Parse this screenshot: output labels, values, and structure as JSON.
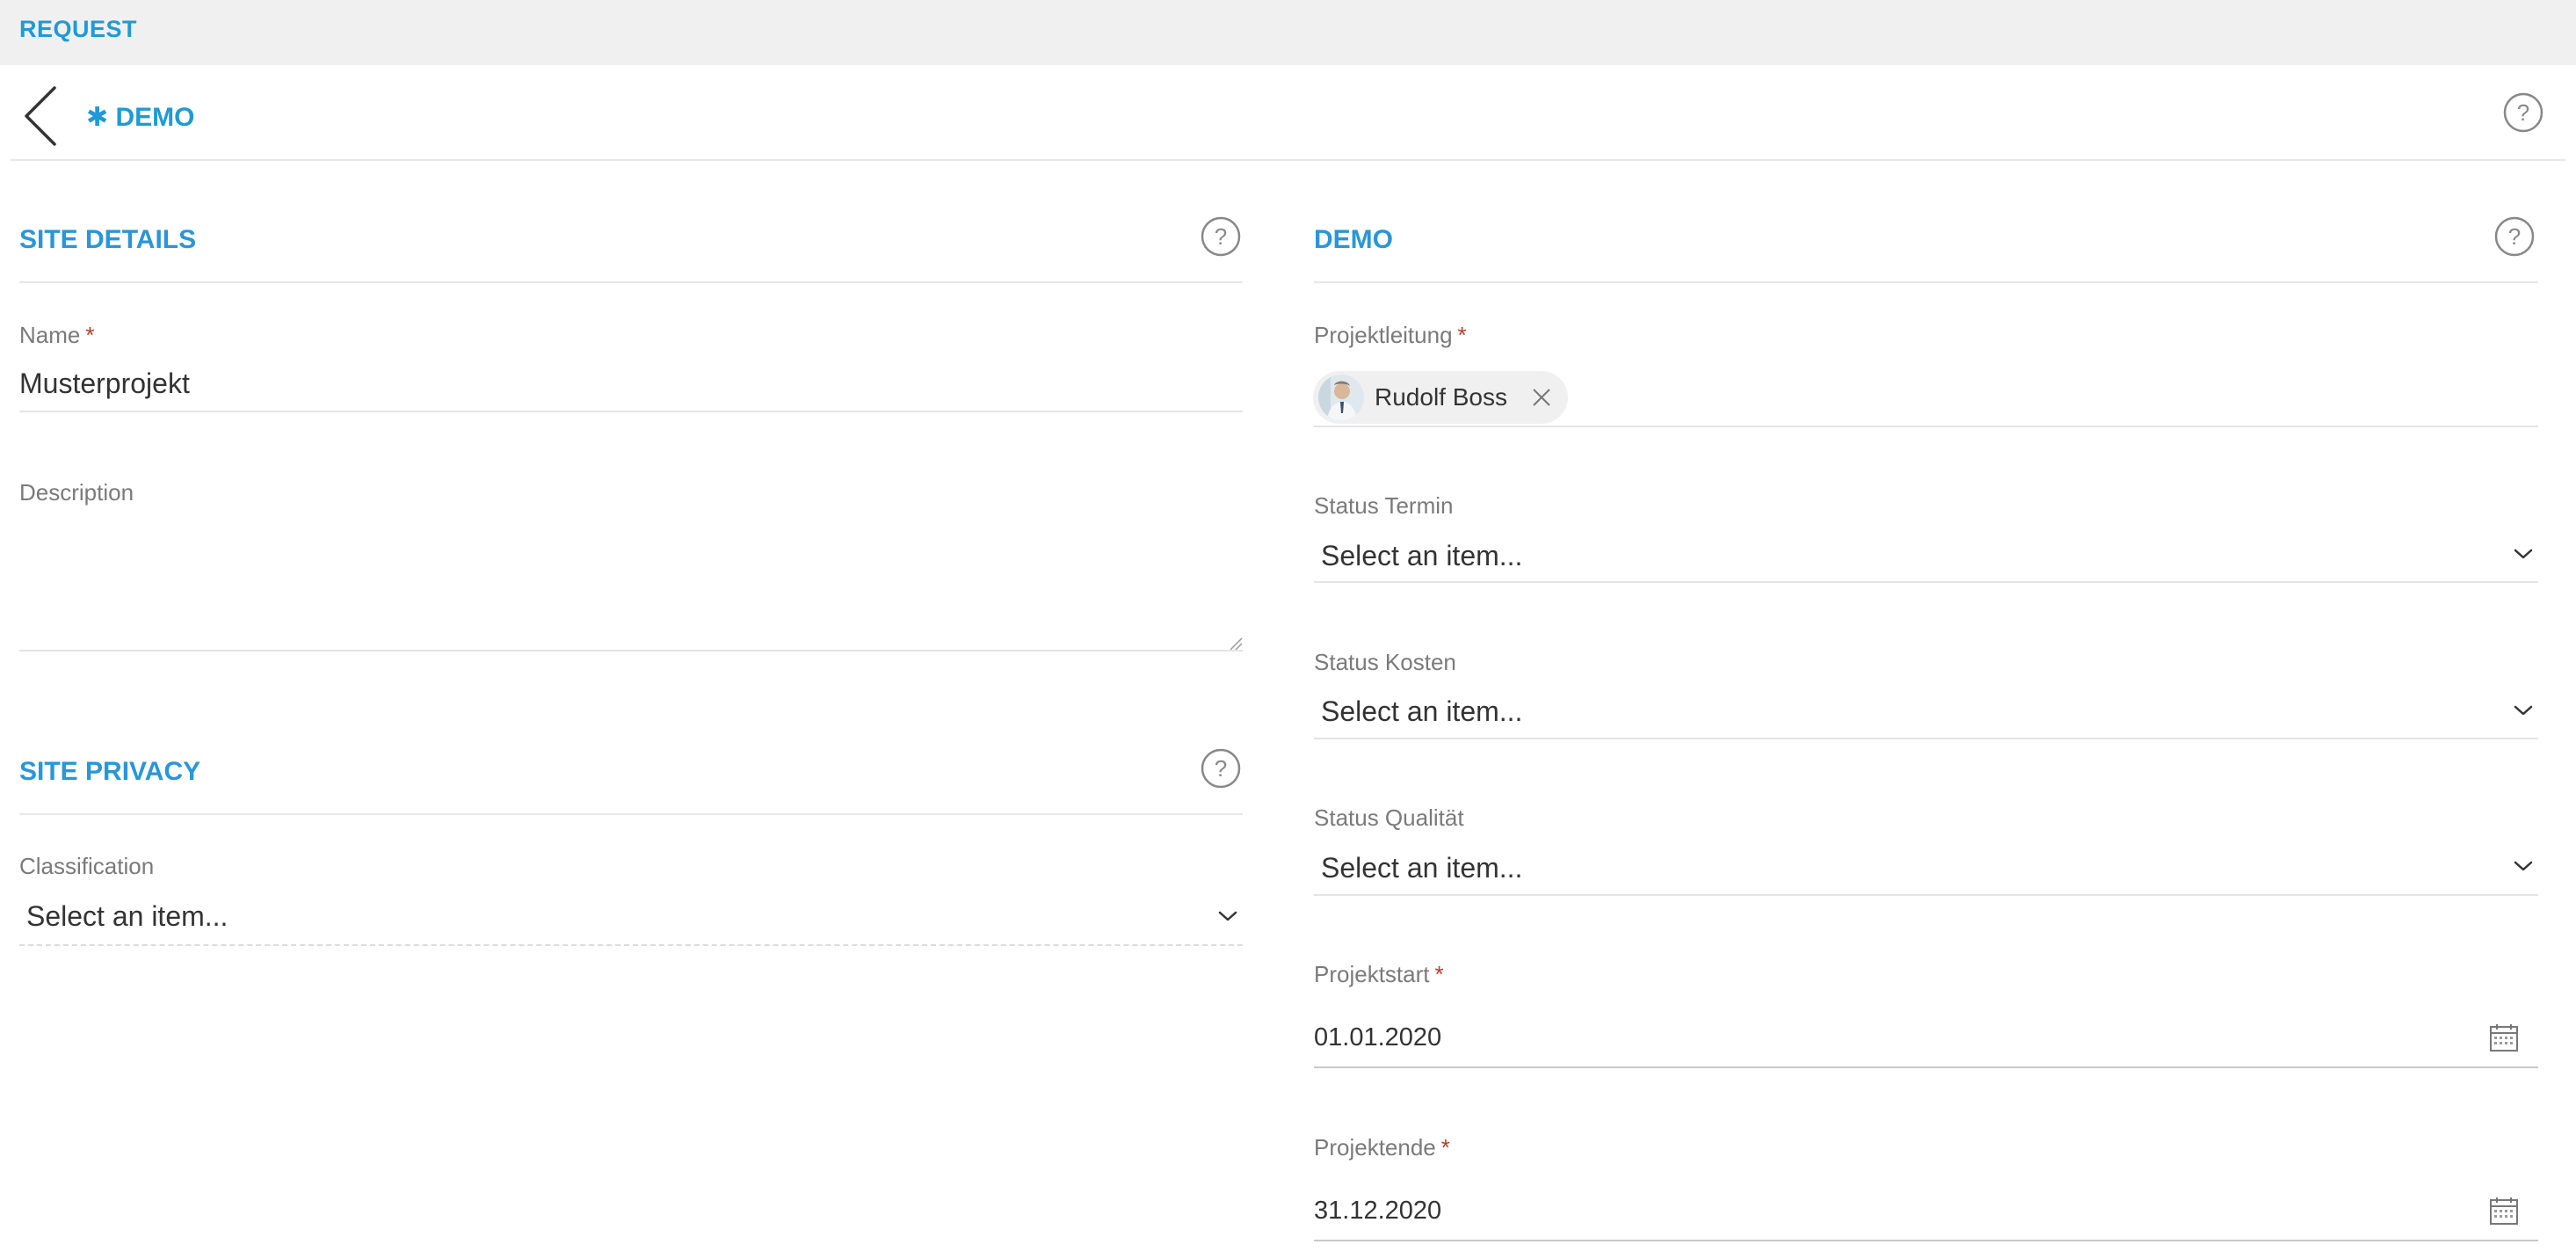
{
  "topbar": {
    "title": "REQUEST"
  },
  "header": {
    "site_name": "✱ DEMO"
  },
  "left": {
    "site_details": {
      "title": "SITE DETAILS",
      "name_label": "Name",
      "name_value": "Musterprojekt",
      "description_label": "Description",
      "description_value": ""
    },
    "site_privacy": {
      "title": "SITE PRIVACY",
      "classification_label": "Classification",
      "classification_value": "Select an item..."
    }
  },
  "right": {
    "title": "DEMO",
    "projektleitung_label": "Projektleitung",
    "projektleitung_person": "Rudolf Boss",
    "status_termin_label": "Status Termin",
    "status_termin_value": "Select an item...",
    "status_kosten_label": "Status Kosten",
    "status_kosten_value": "Select an item...",
    "status_qualitaet_label": "Status Qualität",
    "status_qualitaet_value": "Select an item...",
    "projektstart_label": "Projektstart",
    "projektstart_value": "01.01.2020",
    "projektende_label": "Projektende",
    "projektende_value": "31.12.2020"
  },
  "required_marker": "*",
  "icons": {
    "back": "chevron-left-icon",
    "help": "question-circle-icon",
    "dropdown": "chevron-down-icon",
    "calendar": "calendar-icon",
    "remove": "close-icon"
  },
  "colors": {
    "accent": "#1f9ad6",
    "required": "#c0392b",
    "topbar_bg": "#f0f0f0"
  }
}
